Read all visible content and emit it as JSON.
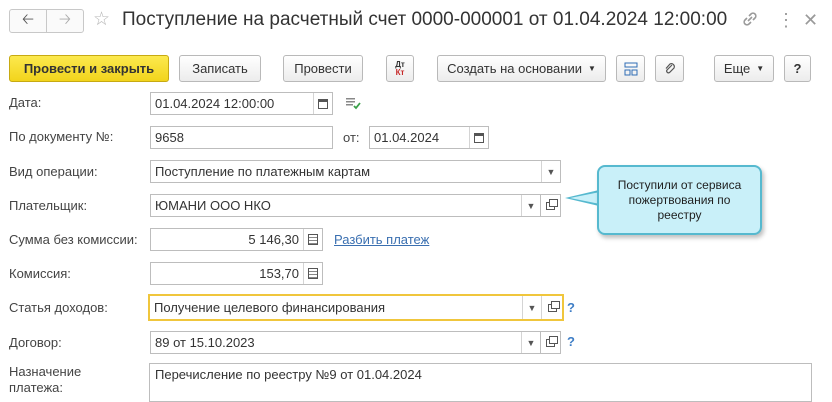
{
  "header": {
    "title": "Поступление на расчетный счет 0000-000001 от 01.04.2024 12:00:00",
    "back_icon": "arrow-left-icon",
    "forward_icon": "arrow-right-icon",
    "favorite_icon": "star-icon",
    "link_icon": "link-icon",
    "more_icon": "vertical-dots-icon",
    "close_icon": "close-icon"
  },
  "toolbar": {
    "post_close": "Провести и закрыть",
    "save": "Записать",
    "post": "Провести",
    "dt": "Дт",
    "kt": "Кт",
    "create_based": "Создать на основании",
    "more": "Еще",
    "help": "?"
  },
  "form": {
    "date": {
      "label": "Дата:",
      "value": "01.04.2024 12:00:00"
    },
    "doc_number": {
      "label": "По документу №:",
      "value": "9658",
      "from_label": "от:",
      "from_value": "01.04.2024"
    },
    "operation_type": {
      "label": "Вид операции:",
      "value": "Поступление по платежным картам"
    },
    "payer": {
      "label": "Плательщик:",
      "value": "ЮМАНИ ООО НКО"
    },
    "amount": {
      "label": "Сумма без комиссии:",
      "value": "5 146,30",
      "split_link": "Разбить платеж"
    },
    "commission": {
      "label": "Комиссия:",
      "value": "153,70"
    },
    "income_item": {
      "label": "Статья доходов:",
      "value": "Получение целевого финансирования",
      "help": "?"
    },
    "contract": {
      "label": "Договор:",
      "value": "89 от 15.10.2023",
      "help": "?"
    },
    "purpose": {
      "label_line1": "Назначение",
      "label_line2": "платежа:",
      "value": "Перечисление по реестру №9 от 01.04.2024"
    }
  },
  "callout": {
    "text": "Поступили от сервиса пожертвования по реестру",
    "colors": {
      "fill": "#c9f0f9",
      "border": "#56b9cf"
    }
  },
  "colors": {
    "primary_button": "#f2d41c",
    "focus_border": "#f0c63c",
    "link": "#3a6fb0"
  }
}
